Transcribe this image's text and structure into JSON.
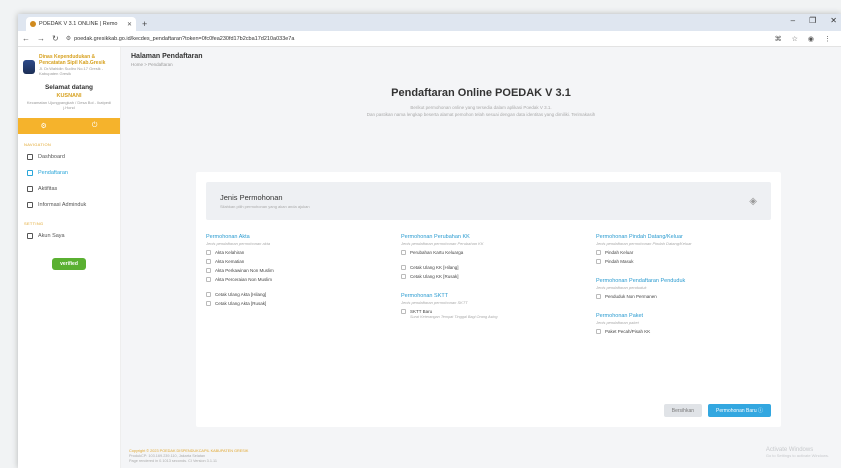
{
  "browser": {
    "tab_title": "POEDAK V 3.1 ONLINE | Remo",
    "url": "poedak.gresikkab.go.id/kecdes_pendaftaran?token=0fc0fea230fd17b2cba17d210a033e7a"
  },
  "sidebar": {
    "brand_title": "Dinas Kependudukan & Pencatatan Sipil Kab.Gresik",
    "brand_sub": "Jl. Dr.Wahidin Sudiro No.17 Gresik - Kabupaten Gresik",
    "welcome": "Selamat datang",
    "user_name": "KUSNANI",
    "user_info": "Kecamatan Ujungpangkah / Desa Bol - Ikatpedi j.Hond",
    "section_main": "NAVIGATION",
    "items": [
      {
        "label": "Dashboard"
      },
      {
        "label": "Pendaftaran"
      },
      {
        "label": "Aktifitas"
      },
      {
        "label": "Informasi Adminduk"
      }
    ],
    "section_settings": "SETTING",
    "settings_item": "Akun Saya",
    "badge": "verified"
  },
  "main": {
    "page_title": "Halaman Pendaftaran",
    "breadcrumb": "Home  >  Pendaftaran",
    "hero_title": "Pendaftaran Online POEDAK V 3.1",
    "hero_line1": "Berikut permohonan online yang tersedia dalam aplikasi Poedak V 3.1.",
    "hero_line2": "Dan pastikan nama lengkap beserta alamat pemohon telah sesuai dengan data identitas yang dimiliki. Terimakasih",
    "card_title": "Jenis Permohonan",
    "card_sub": "Silahkan pilih permohonan yang akan anda ajukan",
    "groups": {
      "akta": {
        "title": "Permohonan Akta",
        "sub": "Jenis pendaftaran permohonan akta",
        "options": [
          "Akta Kelahiran",
          "Akta Kematian",
          "Akta Perkawinan Non Muslim",
          "Akta Perceraian Non Muslim"
        ],
        "options2": [
          "Cetak Ulang Akta [Hilang]",
          "Cetak Ulang Akta [Rusak]"
        ]
      },
      "kk": {
        "title": "Permohonan Perubahan KK",
        "sub": "Jenis pendaftaran permohonan Perubahan KK",
        "options": [
          "Perubahan Kartu Keluarga"
        ],
        "options2": [
          "Cetak Ulang KK [Hilang]",
          "Cetak Ulang KK [Rusak]"
        ]
      },
      "sktt": {
        "title": "Permohonan SKTT",
        "sub": "Jenis pendaftaran permohonan SKTT",
        "option": "SKTT Baru",
        "option_sub": "Surat Keterangan Tempat Tinggal Bagi Orang Asing"
      },
      "pindah": {
        "title": "Permohonan Pindah Datang/Keluar",
        "sub": "Jenis pendaftaran permohonan Pindah Datang/Keluar",
        "options": [
          "Pindah Keluar",
          "Pindah Masuk"
        ]
      },
      "penduduk": {
        "title": "Permohonan Pendaftaran Penduduk",
        "sub": "Jenis pendaftaran penduduk",
        "options": [
          "Penduduk Non Permanen"
        ]
      },
      "paket": {
        "title": "Permohonan Paket",
        "sub": "Jenis pendaftaran paket",
        "options": [
          "Paket Pecah/Pisah KK"
        ]
      }
    },
    "btn_reset": "Bersihkan",
    "btn_next": "Permohonan Baru ⓘ",
    "footer1": "Copyright © 2023 POEDAK DISPENDUKCAPIL KABUPATEN GRESIK",
    "footer2": "ProdukCP: 103.169.239.110, Jakarta Selatan",
    "footer3": "Page rendered in 0.1013 seconds. CI Version 3.1.11",
    "watermark": "Activate Windows",
    "watermark_sub": "Go to Settings to activate Windows."
  }
}
